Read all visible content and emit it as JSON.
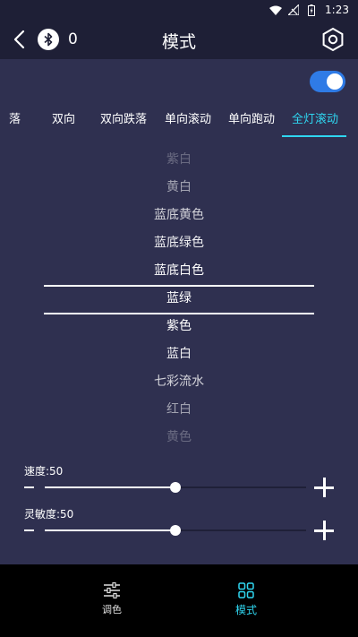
{
  "status_bar": {
    "time": "1:23"
  },
  "header": {
    "title": "模式",
    "bluetooth_count": "0"
  },
  "toggle": {
    "on": true
  },
  "tabs": [
    {
      "label": "落"
    },
    {
      "label": "双向"
    },
    {
      "label": "双向跌落"
    },
    {
      "label": "单向滚动"
    },
    {
      "label": "单向跑动"
    },
    {
      "label": "全灯滚动",
      "active": true
    }
  ],
  "picker": {
    "items": [
      "紫白",
      "黄白",
      "蓝底黄色",
      "蓝底绿色",
      "蓝底白色",
      "蓝绿",
      "紫色",
      "蓝白",
      "七彩流水",
      "红白",
      "黄色"
    ],
    "selected": "蓝绿"
  },
  "sliders": {
    "speed": {
      "label": "速度:50",
      "value": 50,
      "max": 100
    },
    "sensitivity": {
      "label": "灵敏度:50",
      "value": 50,
      "max": 100
    }
  },
  "bottom_nav": [
    {
      "label": "调色",
      "icon": "sliders-icon"
    },
    {
      "label": "模式",
      "icon": "grid-icon",
      "active": true
    }
  ],
  "colors": {
    "accent": "#2fd6f0",
    "background": "#2f3050",
    "toggle": "#2f7be6"
  }
}
